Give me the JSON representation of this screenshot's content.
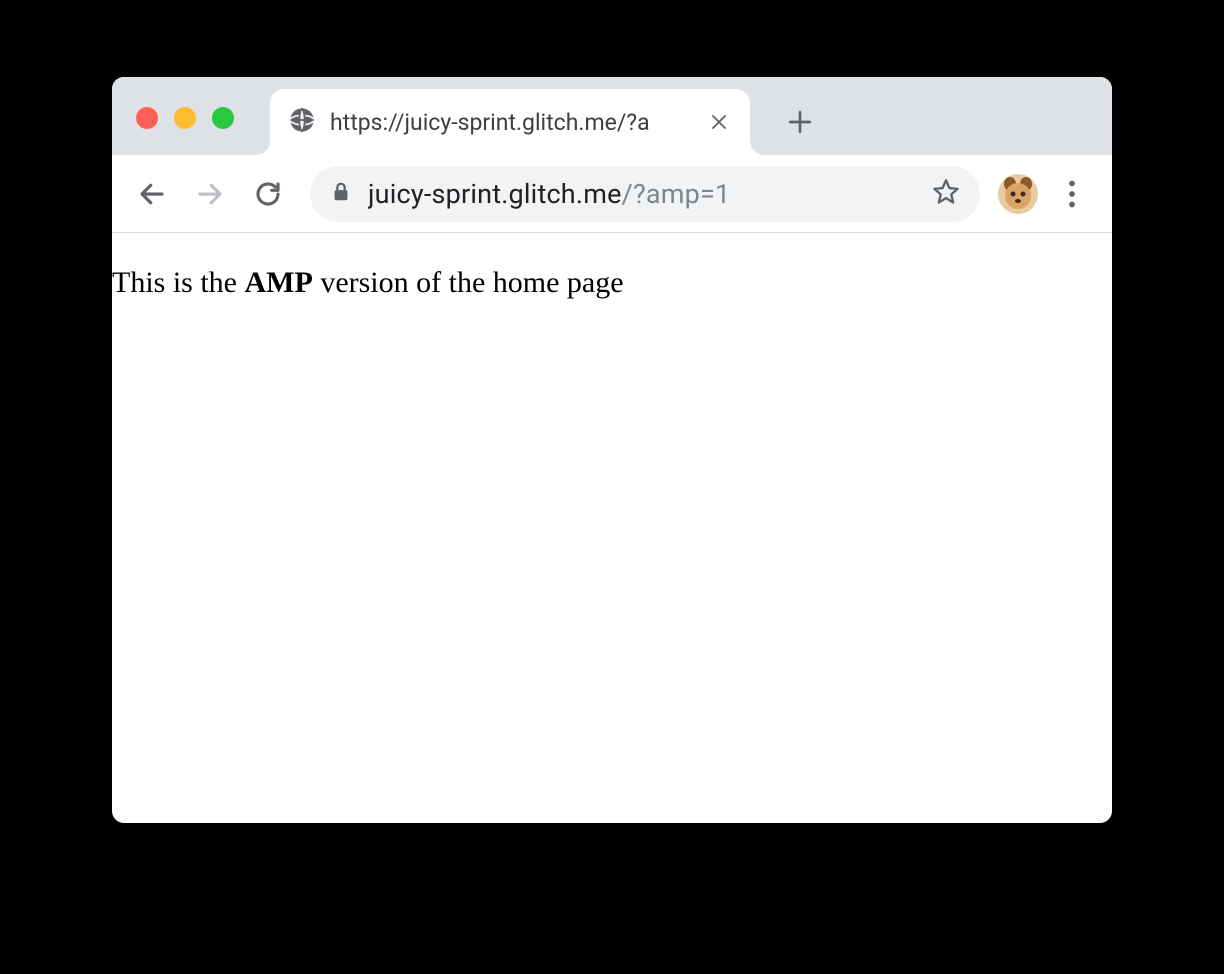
{
  "tab": {
    "title": "https://juicy-sprint.glitch.me/?a"
  },
  "toolbar": {
    "url_host": "juicy-sprint.glitch.me",
    "url_query": "/?amp=1"
  },
  "content": {
    "text_before": "This is the ",
    "bold_text": "AMP",
    "text_after": " version of the home page"
  }
}
